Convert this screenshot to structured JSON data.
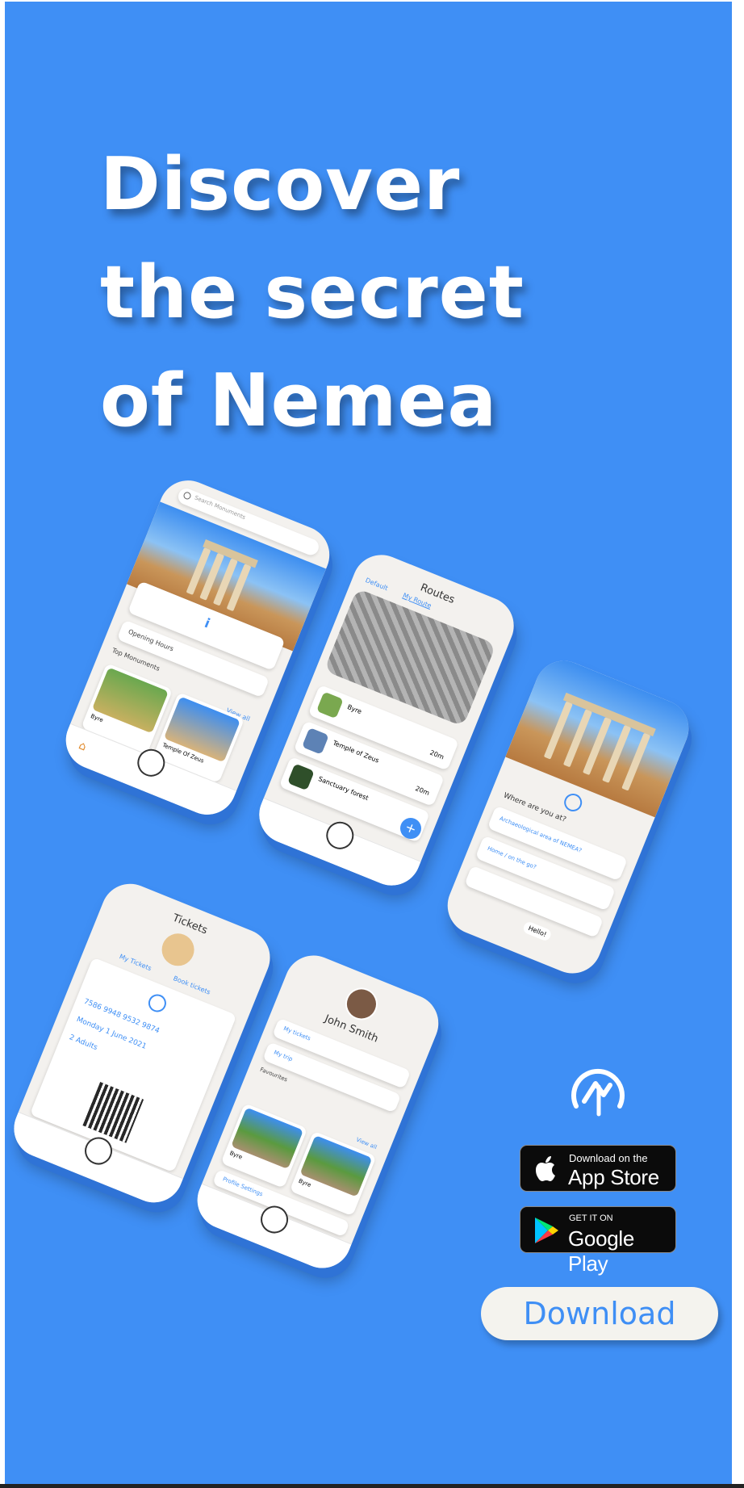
{
  "headline": {
    "line1": "Discover",
    "line2": "the secret",
    "line3": "of Nemea"
  },
  "screens": {
    "home": {
      "search_placeholder": "Search Monuments",
      "opening_hours": "Opening Hours",
      "top_monuments": "Top Monuments",
      "view_all": "View all",
      "card1": "Byre",
      "card2": "Temple Of Zeus"
    },
    "routes": {
      "title": "Routes",
      "tab_default": "Default",
      "tab_my_route": "My Route",
      "stop1": "Byre",
      "stop1_time": "20m",
      "stop2": "Temple of Zeus",
      "stop2_time": "20m",
      "stop3": "Sanctuary forest",
      "stop3_time": "20m",
      "add_label": "+"
    },
    "chat": {
      "question": "Where are you at?",
      "option1": "Archaeological area of NEMEA?",
      "option2": "Home / on the go?",
      "greeting": "Hello!"
    },
    "tickets": {
      "title": "Tickets",
      "tab_my_tickets": "My Tickets",
      "tab_book": "Book tickets",
      "ticket_number": "7586 9948 9532 9874",
      "date": "Monday 1 June 2021",
      "visitors": "2 Adults"
    },
    "profile": {
      "name": "John Smith",
      "my_tickets": "My tickets",
      "my_trip": "My trip",
      "favourites": "Favourites",
      "view_all": "View all",
      "card1": "Byre",
      "card2": "Byre",
      "profile_settings": "Profile Settings"
    }
  },
  "stores": {
    "apple_small": "Download on the",
    "apple_big": "App Store",
    "google_small": "GET IT ON",
    "google_big": "Google Play"
  },
  "cta": {
    "download_label": "Download"
  },
  "colors": {
    "background": "#3f8ff5",
    "accent_text": "#3f8ff5",
    "button_bg": "#f4f3ee",
    "store_bg": "#0b0b0b"
  },
  "icons": [
    "apple-icon",
    "google-play-icon",
    "nemea-logo",
    "search-icon",
    "home-icon",
    "qr-code"
  ]
}
